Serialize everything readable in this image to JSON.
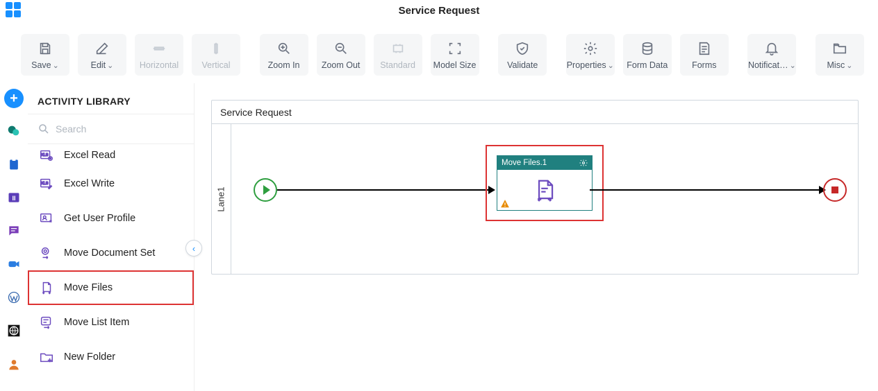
{
  "header": {
    "title": "Service Request"
  },
  "toolbar": {
    "save": "Save",
    "edit": "Edit",
    "horizontal": "Horizontal",
    "vertical": "Vertical",
    "zoom_in": "Zoom In",
    "zoom_out": "Zoom Out",
    "standard": "Standard",
    "model_size": "Model Size",
    "validate": "Validate",
    "properties": "Properties",
    "form_data": "Form Data",
    "forms": "Forms",
    "notifications": "Notificat…",
    "misc": "Misc"
  },
  "panel": {
    "title": "ACTIVITY LIBRARY",
    "search_placeholder": "Search",
    "items": [
      {
        "label": "Excel Read",
        "selected": false
      },
      {
        "label": "Excel Write",
        "selected": false
      },
      {
        "label": "Get User Profile",
        "selected": false
      },
      {
        "label": "Move Document Set",
        "selected": false
      },
      {
        "label": "Move Files",
        "selected": true
      },
      {
        "label": "Move List Item",
        "selected": false
      },
      {
        "label": "New Folder",
        "selected": false
      }
    ]
  },
  "canvas": {
    "process_title": "Service Request",
    "lane_label": "Lane1",
    "activity": {
      "title": "Move Files.1"
    }
  },
  "colors": {
    "primary": "#1890ff",
    "teal": "#20807f",
    "danger": "#d33",
    "start": "#2e9e3f",
    "end": "#c62828"
  }
}
